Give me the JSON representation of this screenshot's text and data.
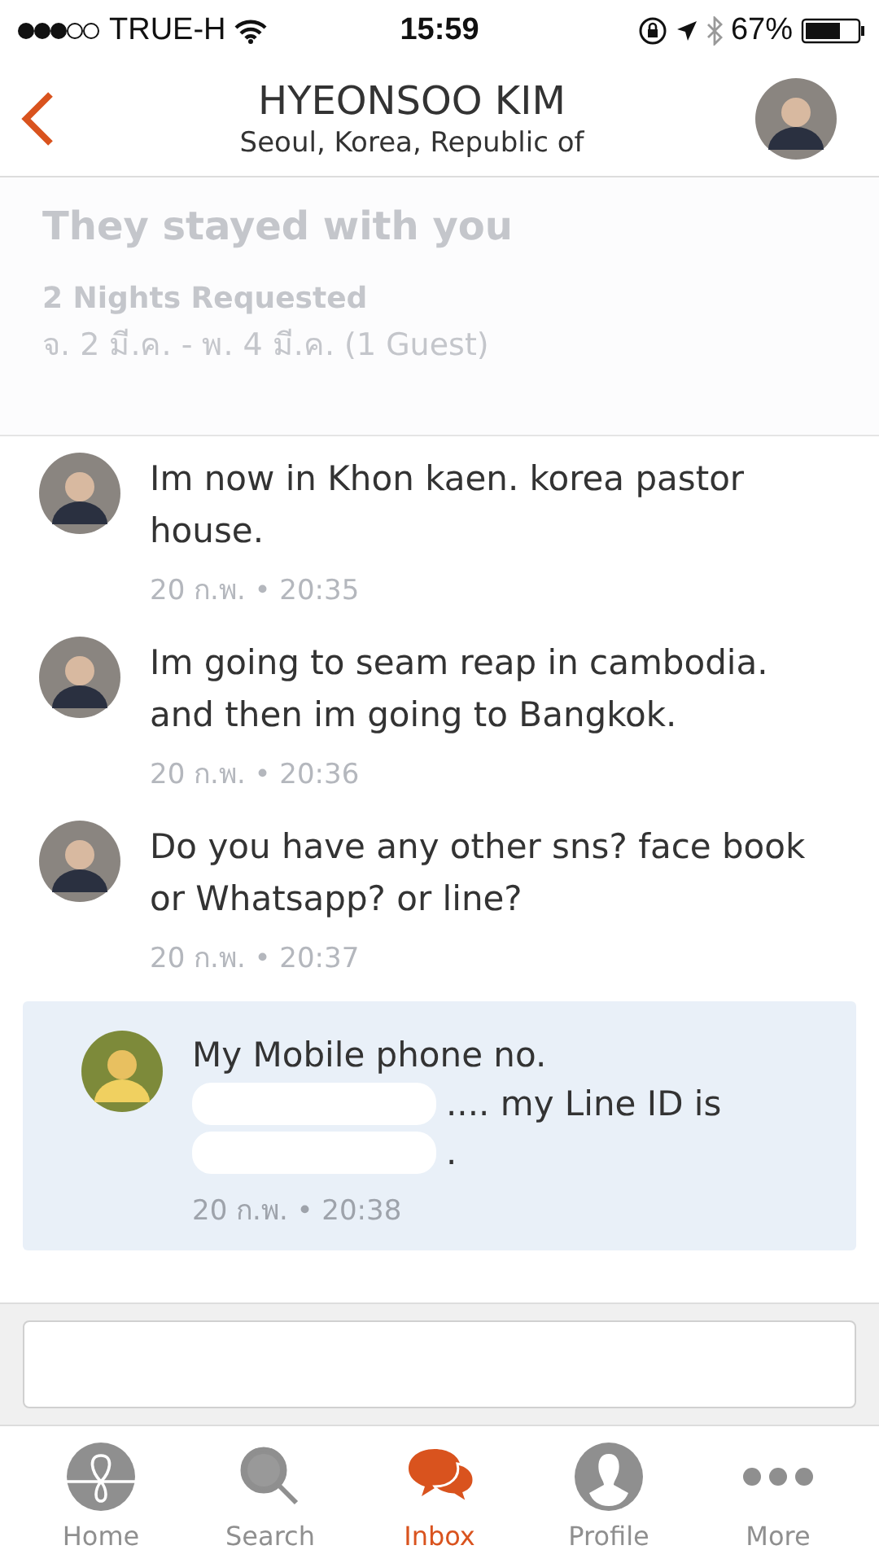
{
  "status_bar": {
    "carrier": "TRUE-H",
    "time": "15:59",
    "battery": "67%"
  },
  "header": {
    "name": "HYEONSOO KIM",
    "location": "Seoul, Korea, Republic of"
  },
  "booking": {
    "title": "They stayed with you",
    "nights": "2 Nights Requested",
    "dates": "จ. 2 มี.ค. - พ. 4 มี.ค. (1 Guest)"
  },
  "messages": [
    {
      "kind": "incoming",
      "lines": [
        [
          {
            "kind": "text",
            "text": "Im now in Khon kaen. korea pastor house."
          }
        ]
      ],
      "time": "20 ก.พ. • 20:35"
    },
    {
      "kind": "incoming",
      "lines": [
        [
          {
            "kind": "text",
            "text": "Im going to seam reap in cambodia. and then im going to Bangkok."
          }
        ]
      ],
      "time": "20 ก.พ. • 20:36"
    },
    {
      "kind": "incoming",
      "lines": [
        [
          {
            "kind": "text",
            "text": "Do you have any other sns? face book or Whatsapp? or line?"
          }
        ]
      ],
      "time": "20 ก.พ. • 20:37"
    },
    {
      "kind": "outgoing",
      "lines": [
        [
          {
            "kind": "text",
            "text": "My Mobile phone no."
          }
        ],
        [
          {
            "kind": "redacted"
          },
          {
            "kind": "text",
            "text": ".... my Line ID is"
          }
        ],
        [
          {
            "kind": "redacted"
          },
          {
            "kind": "text",
            "text": "."
          }
        ]
      ],
      "time": "20 ก.พ. • 20:38"
    }
  ],
  "tabs": [
    {
      "label": "Home",
      "kind": "home",
      "selected": false
    },
    {
      "label": "Search",
      "kind": "search",
      "selected": false
    },
    {
      "label": "Inbox",
      "kind": "inbox",
      "selected": true
    },
    {
      "label": "Profile",
      "kind": "profile",
      "selected": false
    },
    {
      "label": "More",
      "kind": "more",
      "selected": false
    }
  ]
}
